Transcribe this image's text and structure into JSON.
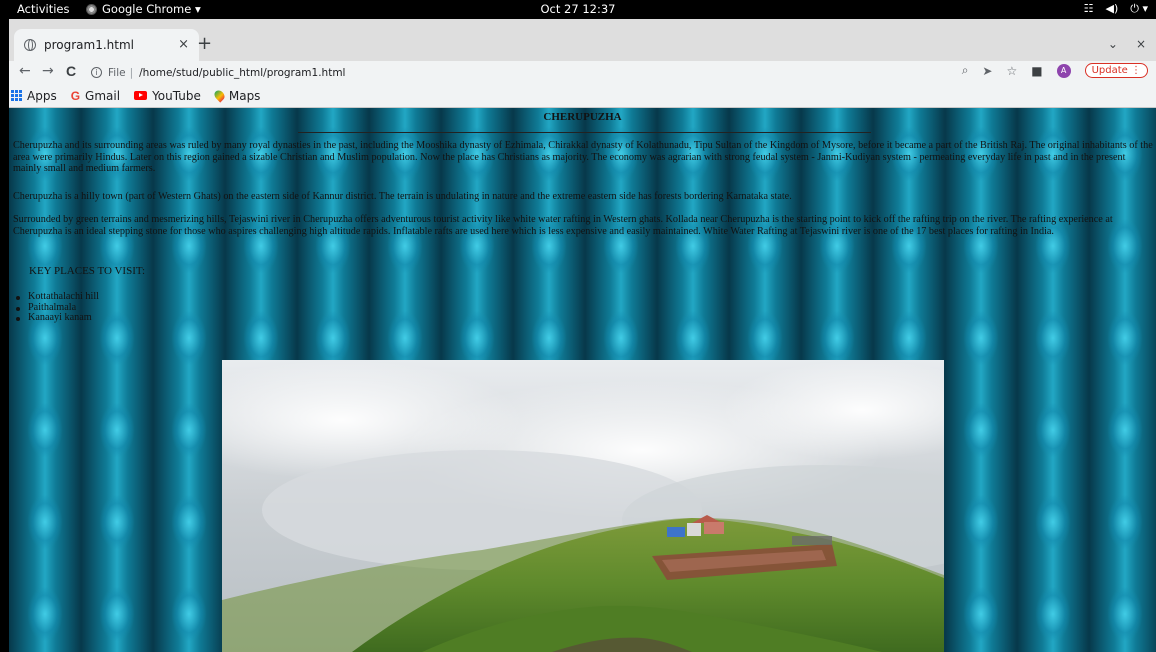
{
  "system_bar": {
    "activities": "Activities",
    "app_name": "Google Chrome ▾",
    "clock": "Oct 27  12:37",
    "tray_network": "☷",
    "tray_volume": "◀)",
    "tray_power": "⏻ ▾"
  },
  "browser": {
    "tab_title": "program1.html",
    "tab_close": "×",
    "new_tab": "+",
    "tab_search": "⌄",
    "window_close": "×",
    "back": "←",
    "forward": "→",
    "reload": "C",
    "url_scheme": "File",
    "url_path": "/home/stud/public_html/program1.html",
    "zoom_icon": "⌕",
    "share_icon": "➤",
    "star_icon": "☆",
    "sidepanel_icon": "■",
    "avatar_letter": "A",
    "update_label": "Update ⋮"
  },
  "bookmarks": [
    {
      "label": "Apps",
      "icon": "apps-grid-icon"
    },
    {
      "label": "Gmail",
      "icon": "google-g-icon"
    },
    {
      "label": "YouTube",
      "icon": "youtube-icon"
    },
    {
      "label": "Maps",
      "icon": "maps-pin-icon"
    }
  ],
  "page": {
    "title": "CHERUPUZHA",
    "paragraph1": "Cherupuzha and its surrounding areas was ruled by many royal dynasties in the past, including the Mooshika dynasty of Ezhimala, Chirakkal dynasty of Kolathunadu, Tipu Sultan of the Kingdom of Mysore, before it became a part of the British Raj. The original inhabitants of the area were primarily Hindus. Later on this region gained a sizable Christian and Muslim population. Now the place has Christians as majority. The economy was agrarian with strong feudal system - Janmi-Kudiyan system - permeating everyday life in past and in the present mainly small and medium farmers.",
    "paragraph2": "Cherupuzha is a hilly town (part of Western Ghats) on the eastern side of Kannur district. The terrain is undulating in nature and the extreme eastern side has forests bordering Karnataka state.",
    "paragraph3": "Surrounded by green terrains and mesmerizing hills, Tejaswini river in Cherupuzha offers adventurous tourist activity like white water rafting in Western ghats. Kollada near Cherupuzha is the starting point to kick off the rafting trip on the river. The rafting experience at Cherupuzha is an ideal stepping stone for those who aspires challenging high altitude rapids. Inflatable rafts are used here which is less expensive and easily maintained. White Water Rafting at Tejaswini river is one of the 17 best places for rafting in India.",
    "key_places_heading": "KEY PLACES TO VISIT:",
    "key_places": [
      "Kottathalachi hill",
      "Paithalmala",
      "Kanaayi kanam"
    ]
  },
  "colors": {
    "background_teal": "#0b5b72",
    "update_red": "#d93025"
  }
}
